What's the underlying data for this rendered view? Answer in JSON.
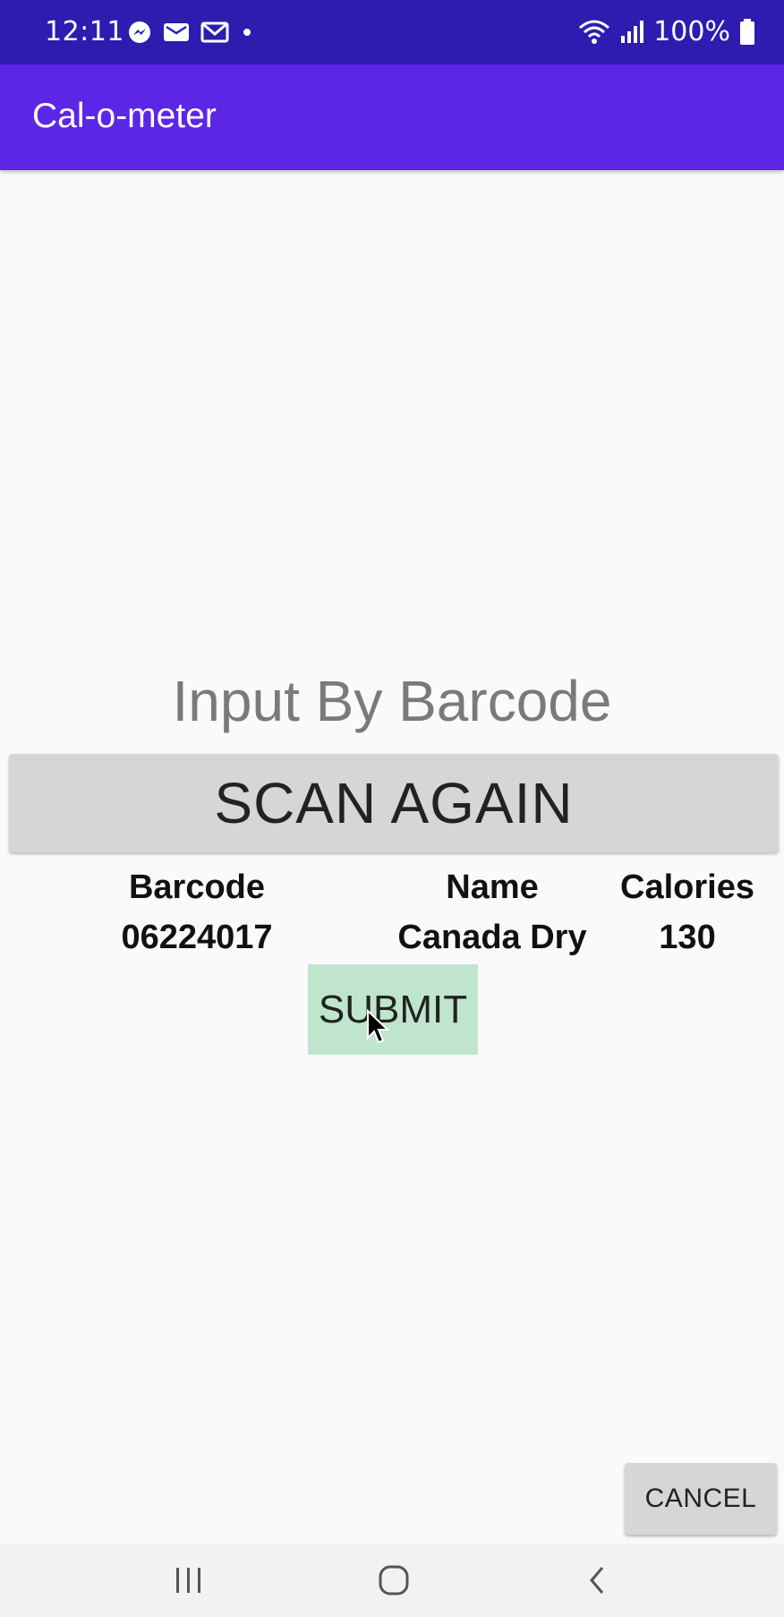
{
  "status_bar": {
    "time": "12:11",
    "battery": "100%",
    "notification_icons": [
      "messenger-icon",
      "mail-icon",
      "gmail-icon",
      "dot-icon"
    ],
    "system_icons": [
      "wifi-icon",
      "signal-icon",
      "battery-icon"
    ]
  },
  "app_bar": {
    "title": "Cal-o-meter",
    "color": "#5b26e6"
  },
  "main": {
    "heading": "Input By Barcode",
    "scan_button": "SCAN AGAIN",
    "columns": [
      {
        "header": "Barcode",
        "value": "06224017"
      },
      {
        "header": "Name",
        "value": "Canada Dry"
      },
      {
        "header": "Calories",
        "value": "130"
      }
    ],
    "submit_button": "SUBMIT",
    "submit_color": "#bfe6cc"
  },
  "footer": {
    "cancel_button": "CANCEL"
  },
  "nav_bar": {
    "icons": [
      "recent-apps-icon",
      "home-icon",
      "back-icon"
    ]
  }
}
